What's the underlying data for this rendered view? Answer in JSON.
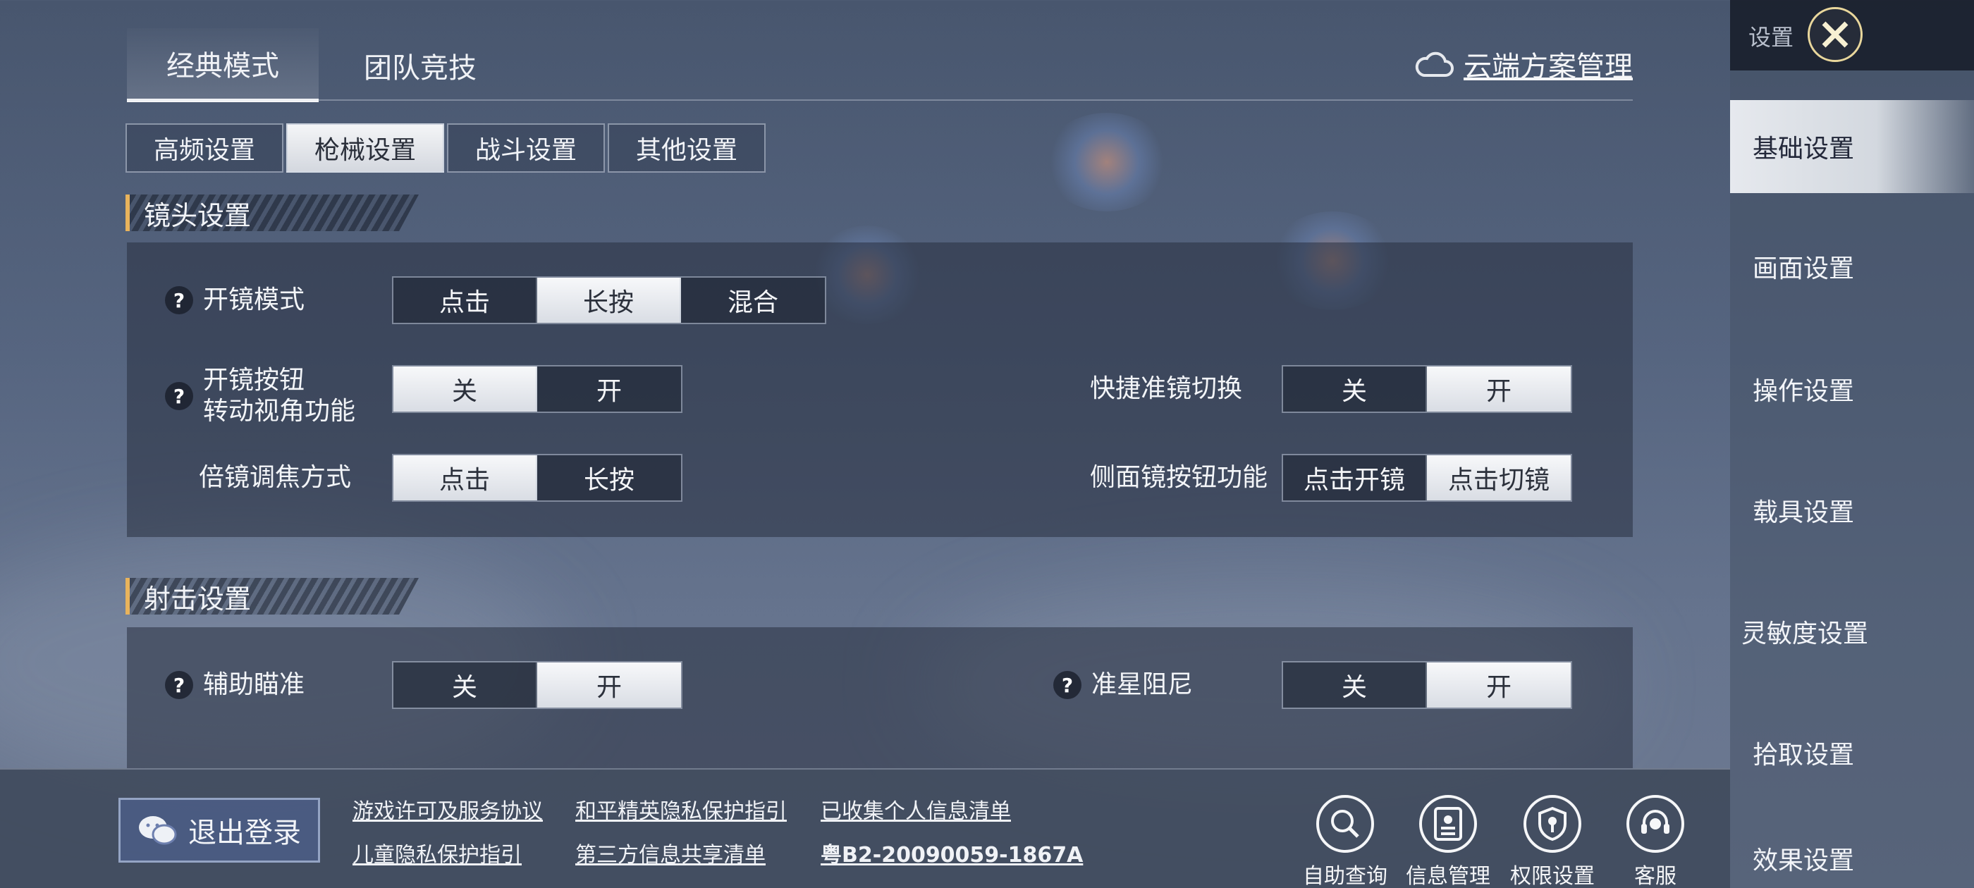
{
  "mode_tabs": [
    "经典模式",
    "团队竞技"
  ],
  "cloud": {
    "label": "云端方案管理",
    "icon": "cloud-icon"
  },
  "sub_tabs": [
    "高频设置",
    "枪械设置",
    "战斗设置",
    "其他设置"
  ],
  "active_sub_tab": "枪械设置",
  "sections": {
    "scope": {
      "title": "镜头设置",
      "scope_mode": {
        "label": "开镜模式",
        "options": [
          "点击",
          "长按",
          "混合"
        ],
        "selected": "长按"
      },
      "scope_button_rotate": {
        "label_line1": "开镜按钮",
        "label_line2": "转动视角功能",
        "options": [
          "关",
          "开"
        ],
        "selected": "关"
      },
      "quick_scope_switch": {
        "label": "快捷准镜切换",
        "options": [
          "关",
          "开"
        ],
        "selected": "开"
      },
      "zoom_method": {
        "label": "倍镜调焦方式",
        "options": [
          "点击",
          "长按"
        ],
        "selected": "点击"
      },
      "side_scope_button": {
        "label": "侧面镜按钮功能",
        "options": [
          "点击开镜",
          "点击切镜"
        ],
        "selected": "点击切镜"
      }
    },
    "shooting": {
      "title": "射击设置",
      "aim_assist": {
        "label": "辅助瞄准",
        "options": [
          "关",
          "开"
        ],
        "selected": "开"
      },
      "crosshair_damping": {
        "label": "准星阻尼",
        "options": [
          "关",
          "开"
        ],
        "selected": "开"
      }
    }
  },
  "sidebar": {
    "title": "设置",
    "items": [
      "基础设置",
      "画面设置",
      "操作设置",
      "载具设置",
      "灵敏度设置",
      "拾取设置",
      "效果设置"
    ],
    "active": "基础设置"
  },
  "bottom": {
    "logout_label": "退出登录",
    "links_row1": [
      "游戏许可及服务协议",
      "和平精英隐私保护指引",
      "已收集个人信息清单"
    ],
    "links_row2": [
      "儿童隐私保护指引",
      "第三方信息共享清单",
      "粤B2-20090059-1867A"
    ],
    "tools": [
      "自助查询",
      "信息管理",
      "权限设置",
      "客服"
    ]
  },
  "colors": {
    "accent": "#e8b35c",
    "selected_button": "#eef0f3",
    "panel": "#2f3749"
  }
}
